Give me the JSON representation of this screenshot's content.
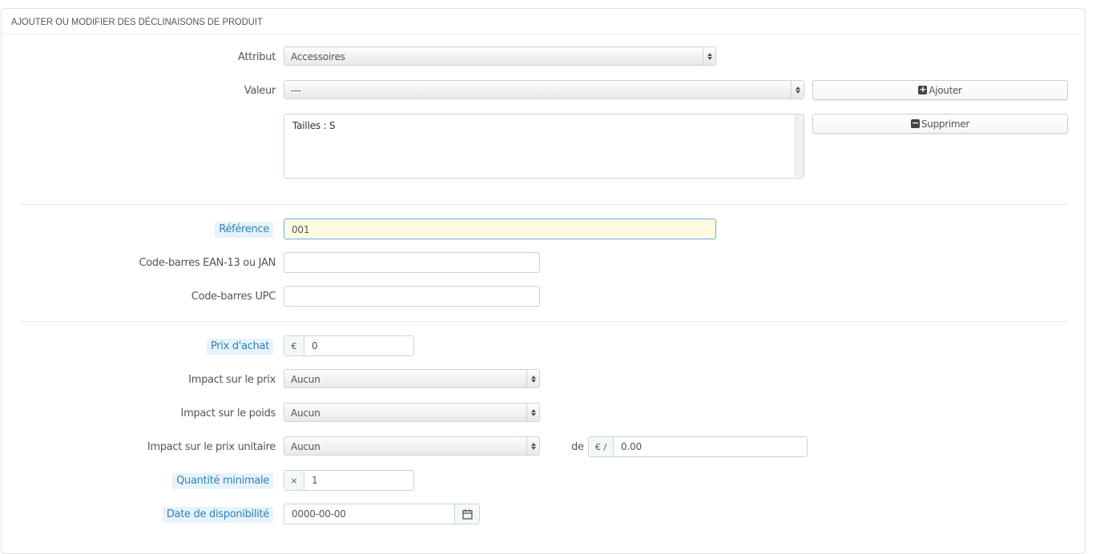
{
  "panel": {
    "title": "AJOUTER OU MODIFIER DES DÉCLINAISONS DE PRODUIT"
  },
  "attribute": {
    "label": "Attribut",
    "value": "Accessoires"
  },
  "value": {
    "label": "Valeur",
    "value": "---"
  },
  "buttons": {
    "add": "Ajouter",
    "remove": "Supprimer"
  },
  "combination_list": {
    "items": [
      "Tailles : S"
    ]
  },
  "reference": {
    "label": "Référence",
    "value": "001"
  },
  "ean13": {
    "label": "Code-barres EAN-13 ou JAN",
    "value": ""
  },
  "upc": {
    "label": "Code-barres UPC",
    "value": ""
  },
  "wholesale_price": {
    "label": "Prix d'achat",
    "currency": "€",
    "value": "0"
  },
  "price_impact": {
    "label": "Impact sur le prix",
    "value": "Aucun"
  },
  "weight_impact": {
    "label": "Impact sur le poids",
    "value": "Aucun"
  },
  "unit_price_impact": {
    "label": "Impact sur le prix unitaire",
    "value": "Aucun",
    "of_label": "de",
    "addon": "€ /",
    "amount": "0.00"
  },
  "min_quantity": {
    "label": "Quantité minimale",
    "addon": "×",
    "value": "1"
  },
  "availability_date": {
    "label": "Date de disponibilité",
    "value": "0000-00-00"
  }
}
